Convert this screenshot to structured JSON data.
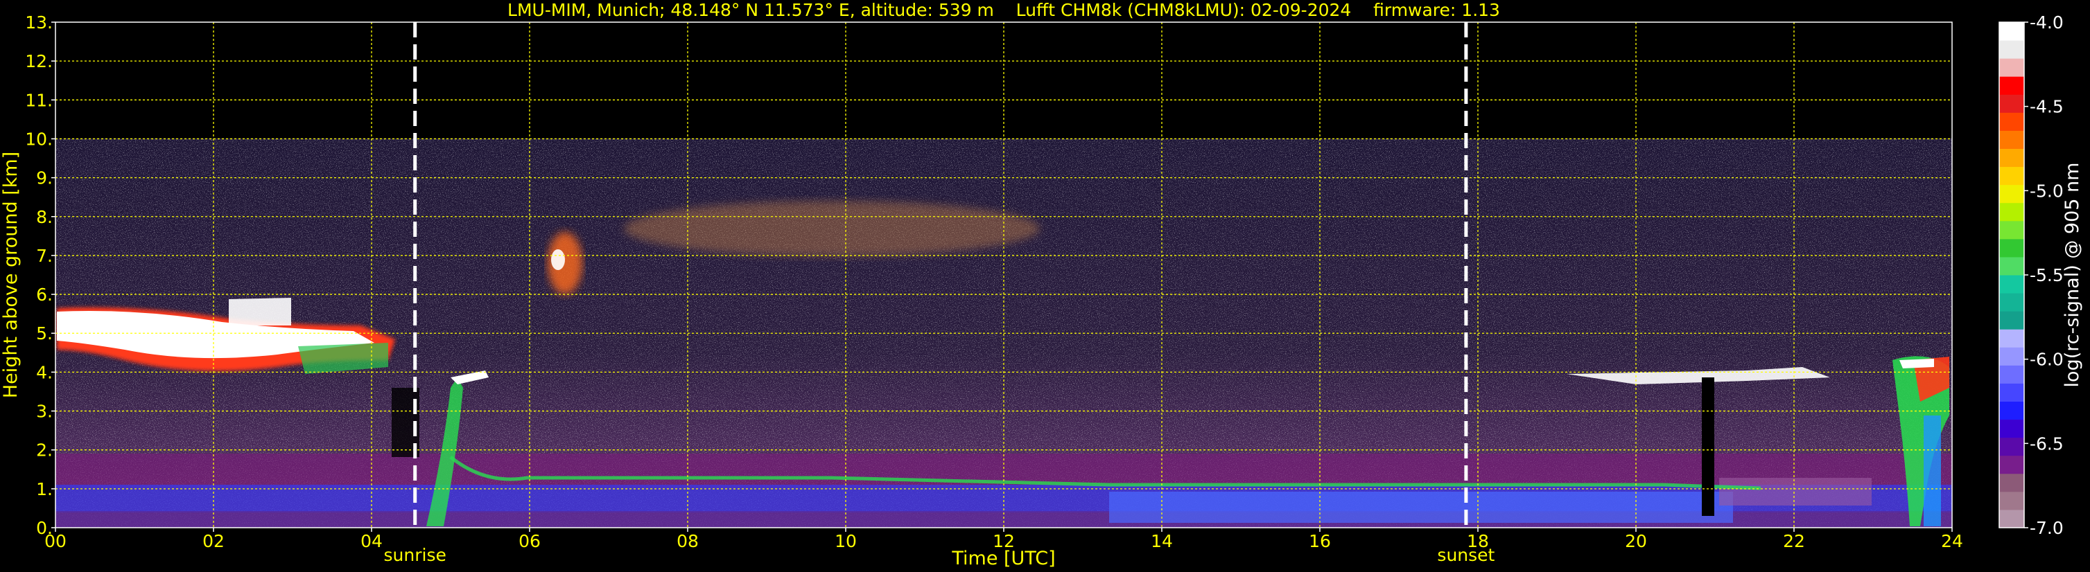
{
  "chart_data": {
    "type": "heatmap",
    "title": "LMU-MIM, Munich; 48.148° N 11.573° E, altitude: 539 m    Lufft CHM8k (CHM8kLMU): 02-09-2024    firmware: 1.13",
    "xlabel": "Time [UTC]",
    "ylabel": "Height above ground [km]",
    "xlim": [
      0,
      24
    ],
    "ylim": [
      0,
      13
    ],
    "x_ticks": [
      "00",
      "02",
      "04",
      "06",
      "08",
      "10",
      "12",
      "14",
      "16",
      "18",
      "20",
      "22",
      "24"
    ],
    "y_ticks": [
      "0.",
      "1.",
      "2.",
      "3.",
      "4.",
      "5.",
      "6.",
      "7.",
      "8.",
      "9.",
      "10.",
      "11.",
      "12.",
      "13."
    ],
    "grid": true,
    "markers": [
      {
        "label": "sunrise",
        "x": 4.55
      },
      {
        "label": "sunset",
        "x": 17.85
      }
    ],
    "colorbar": {
      "label": "log(rc-signal) @ 905 nm",
      "ticks": [
        "-4.0",
        "-4.5",
        "-5.0",
        "-5.5",
        "-6.0",
        "-6.5",
        "-7.0"
      ],
      "range": [
        -7.0,
        -4.0
      ],
      "colors": [
        "#b496aa",
        "#a0788c",
        "#8c5a78",
        "#781e8c",
        "#5a0aaa",
        "#3c00d2",
        "#1e1eff",
        "#4646ff",
        "#6e6eff",
        "#9696ff",
        "#b4b4ff",
        "#14a08c",
        "#14b496",
        "#14c8a0",
        "#50dc64",
        "#32c832",
        "#78e632",
        "#b4f000",
        "#f0f000",
        "#ffd200",
        "#ffaa00",
        "#ff7800",
        "#ff4600",
        "#e61e1e",
        "#ff0000",
        "#f0b4b4",
        "#ebebeb",
        "#ffffff"
      ]
    }
  }
}
